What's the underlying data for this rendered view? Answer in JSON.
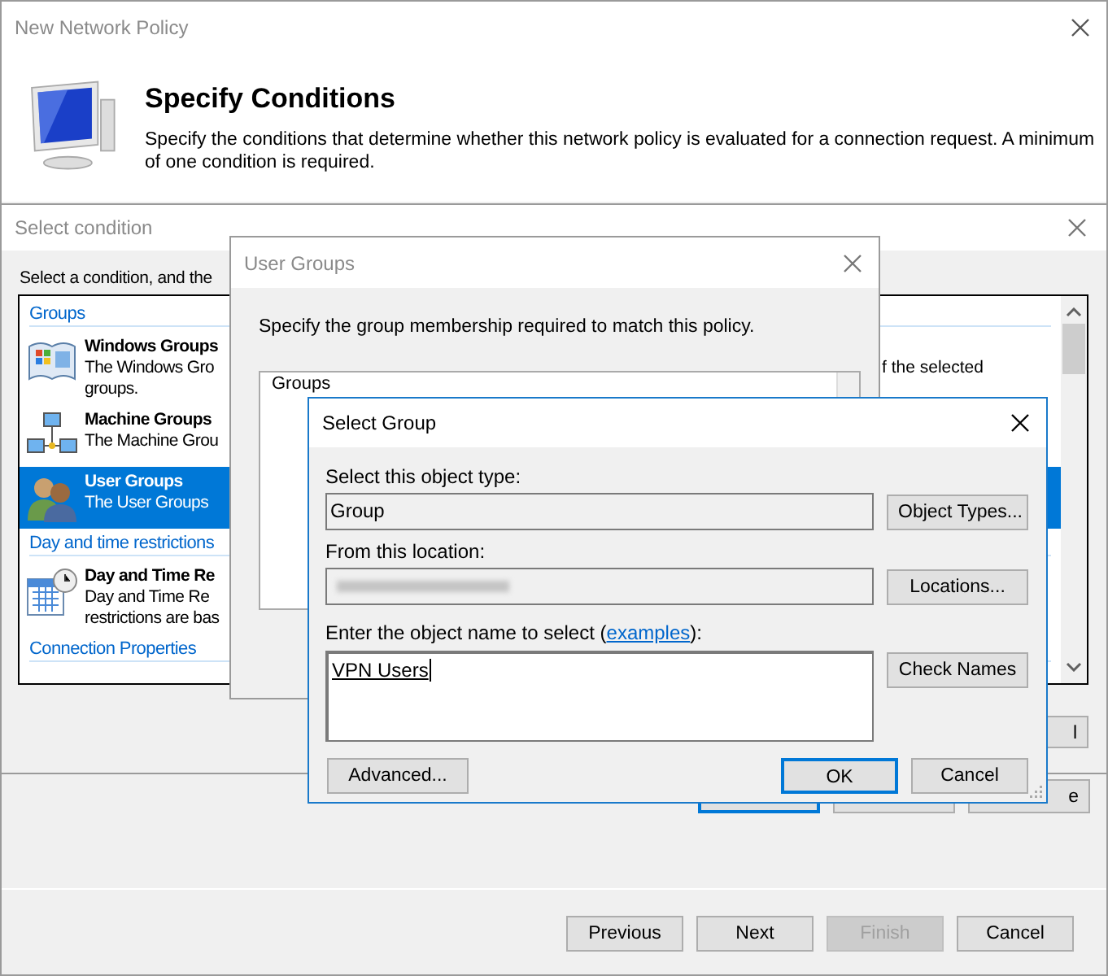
{
  "main_window": {
    "title": "New Network Policy",
    "heading": "Specify Conditions",
    "description": "Specify the conditions that determine whether this network policy is evaluated for a connection request. A minimum of one condition is required.",
    "covered_buttons": [
      {
        "default": true
      },
      {
        "default": false
      },
      {
        "label": "e",
        "default": false
      }
    ],
    "footer_buttons": [
      {
        "label": "Previous",
        "disabled": false
      },
      {
        "label": "Next",
        "disabled": false
      },
      {
        "label": "Finish",
        "disabled": true
      },
      {
        "label": "Cancel",
        "disabled": false
      }
    ]
  },
  "select_condition": {
    "title": "Select condition",
    "instruction": "Select a condition, and the",
    "list": [
      {
        "kind": "header",
        "label": "Groups"
      },
      {
        "kind": "item",
        "title": "Windows Groups",
        "lines": [
          "The Windows Gro",
          "groups."
        ],
        "tail": "f the selected",
        "selected": false
      },
      {
        "kind": "item",
        "title": "Machine Groups",
        "lines": [
          "The Machine Grou"
        ],
        "selected": false
      },
      {
        "kind": "item",
        "title": "User Groups",
        "lines": [
          "The User Groups"
        ],
        "selected": true
      },
      {
        "kind": "header",
        "label": "Day and time restrictions"
      },
      {
        "kind": "item",
        "title": "Day and Time Re",
        "lines": [
          "Day and Time Re",
          "restrictions are bas"
        ],
        "selected": false
      },
      {
        "kind": "header",
        "label": "Connection Properties"
      }
    ],
    "covered_button": {
      "label": "l"
    }
  },
  "user_groups": {
    "title": "User Groups",
    "instruction": "Specify the group membership required to match this policy.",
    "list_header": "Groups"
  },
  "select_group": {
    "title": "Select Group",
    "object_type_label": "Select this object type:",
    "object_type": "Group",
    "object_types_button": "Object Types...",
    "location_label": "From this location:",
    "locations_button": "Locations...",
    "name_label_start": "Enter the object name to select (",
    "examples_link": "examples",
    "name_label_end": "):",
    "names": "VPN Users",
    "check_names_button": "Check Names",
    "advanced_button": "Advanced...",
    "buttons": [
      {
        "label": "OK",
        "default": true
      },
      {
        "label": "Cancel",
        "default": false
      }
    ]
  }
}
